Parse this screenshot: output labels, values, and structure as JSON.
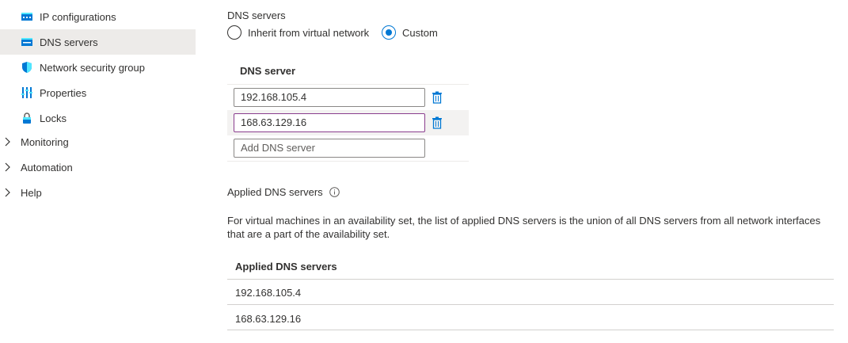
{
  "sidebar": {
    "items": [
      {
        "label": "IP configurations",
        "icon": "ip-configurations-icon"
      },
      {
        "label": "DNS servers",
        "icon": "dns-servers-icon",
        "selected": true
      },
      {
        "label": "Network security group",
        "icon": "shield-icon"
      },
      {
        "label": "Properties",
        "icon": "properties-icon"
      },
      {
        "label": "Locks",
        "icon": "lock-icon"
      }
    ],
    "groups": [
      {
        "label": "Monitoring"
      },
      {
        "label": "Automation"
      },
      {
        "label": "Help"
      }
    ]
  },
  "dns": {
    "section_label": "DNS servers",
    "options": [
      {
        "label": "Inherit from virtual network",
        "checked": false
      },
      {
        "label": "Custom",
        "checked": true
      }
    ],
    "table_header": "DNS server",
    "servers": [
      "192.168.105.4",
      "168.63.129.16"
    ],
    "add_placeholder": "Add DNS server"
  },
  "applied": {
    "title": "Applied DNS servers",
    "description_line1": "For virtual machines in an availability set, the list of applied DNS servers is the union of all DNS servers from all network interfaces",
    "description_line2": "that are a part of the availability set.",
    "table_header": "Applied DNS servers",
    "rows": [
      "192.168.105.4",
      "168.63.129.16"
    ]
  },
  "colors": {
    "accent": "#0078d4",
    "selected_bg": "#edebe9",
    "focus_border": "#8a3d8e"
  }
}
